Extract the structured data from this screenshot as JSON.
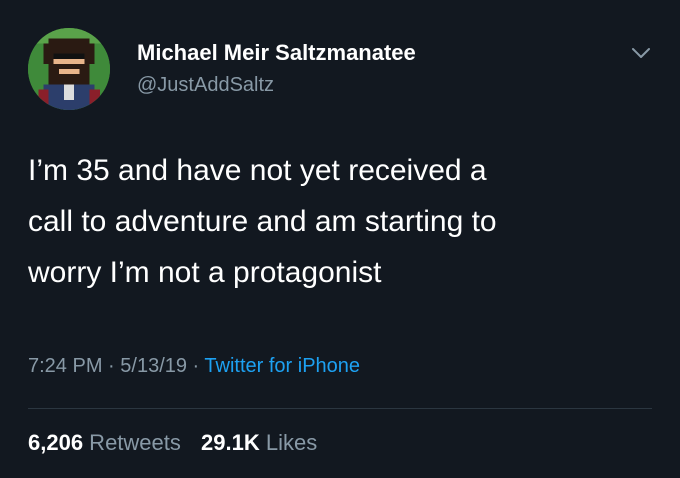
{
  "user": {
    "display_name": "Michael Meir Saltzmanatee",
    "handle": "@JustAddSaltz"
  },
  "tweet": {
    "lines": [
      "I’m 35 and have not yet received a",
      "call to adventure and am starting to",
      "worry I’m not a protagonist"
    ]
  },
  "meta": {
    "time": "7:24 PM",
    "sep1": " · ",
    "date": "5/13/19",
    "sep2": " · ",
    "source": "Twitter for iPhone"
  },
  "stats": {
    "retweets_count": "6,206",
    "retweets_label": " Retweets",
    "likes_count": "29.1K",
    "likes_label": " Likes"
  },
  "icons": {
    "menu": "chevron-down-icon",
    "avatar": "pixel-art-avatar"
  },
  "colors": {
    "background": "#121820",
    "text": "#ffffff",
    "muted": "#8899a6",
    "link": "#1da1f2",
    "divider": "#2b3640"
  }
}
